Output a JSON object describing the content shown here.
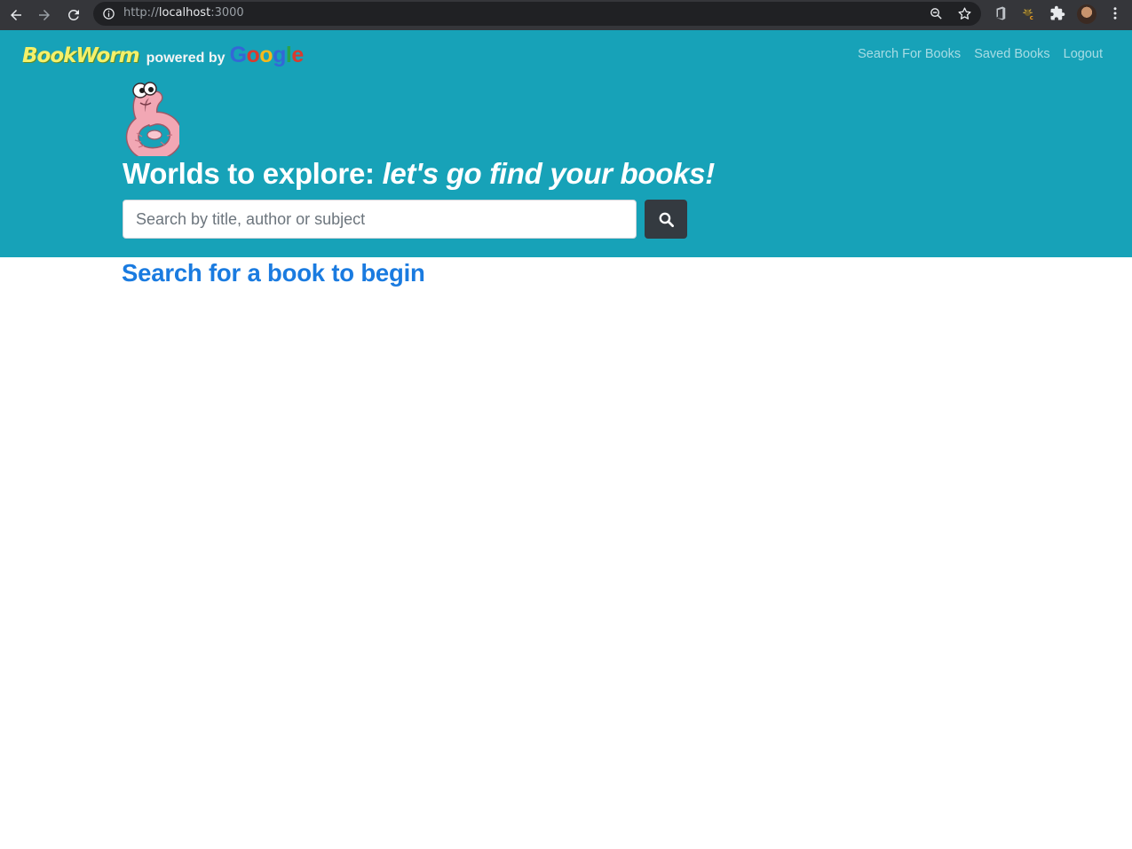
{
  "browser": {
    "url_scheme": "http://",
    "url_host": "localhost",
    "url_port": ":3000"
  },
  "brand": {
    "name": "BookWorm",
    "powered_by": "powered by",
    "google_letters": [
      "G",
      "o",
      "o",
      "g",
      "l",
      "e"
    ]
  },
  "nav": {
    "search_link": "Search For Books",
    "saved_link": "Saved Books",
    "logout_link": "Logout"
  },
  "hero": {
    "headline_plain": "Worlds to explore: ",
    "headline_italic": "let's go find your books!",
    "search_placeholder": "Search by title, author or subject",
    "search_value": ""
  },
  "results": {
    "heading": "Search for a book to begin"
  },
  "colors": {
    "hero_bg": "#17a2b8",
    "search_button_bg": "#343a40",
    "heading_blue": "#1a7be0"
  },
  "icons": {
    "back": "back-arrow-icon",
    "forward": "forward-arrow-icon",
    "reload": "reload-icon",
    "site_info": "info-icon",
    "zoom": "zoom-icon",
    "bookmark": "star-icon",
    "search": "search-icon"
  }
}
